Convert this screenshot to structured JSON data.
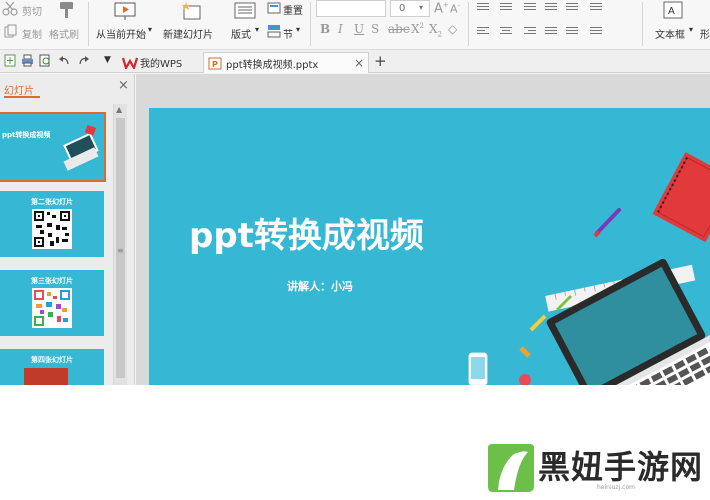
{
  "ribbon": {
    "cut": "剪切",
    "copy": "复制",
    "format_painter": "格式刷",
    "from_current": "从当前开始",
    "new_slide": "新建幻灯片",
    "layout": "版式",
    "reset": "重置",
    "section": "节",
    "font_size": "0",
    "text_box": "文本框",
    "shape": "形"
  },
  "quick_bar": {
    "tabs": [
      {
        "label": "我的WPS"
      },
      {
        "label": "ppt转换成视频.pptx"
      }
    ],
    "new_tab": "+"
  },
  "panel": {
    "title": "幻灯片",
    "close": "×",
    "thumbnails": [
      {
        "title": "ppt转换成视频"
      },
      {
        "title": "第二张幻灯片"
      },
      {
        "title": "第三张幻灯片"
      },
      {
        "title": "第四张幻灯片"
      }
    ]
  },
  "slide": {
    "title": "ppt转换成视频",
    "subtitle": "讲解人：小冯"
  },
  "watermark": {
    "brand": "黑妞手游网",
    "url": "heiniuzj.com"
  }
}
